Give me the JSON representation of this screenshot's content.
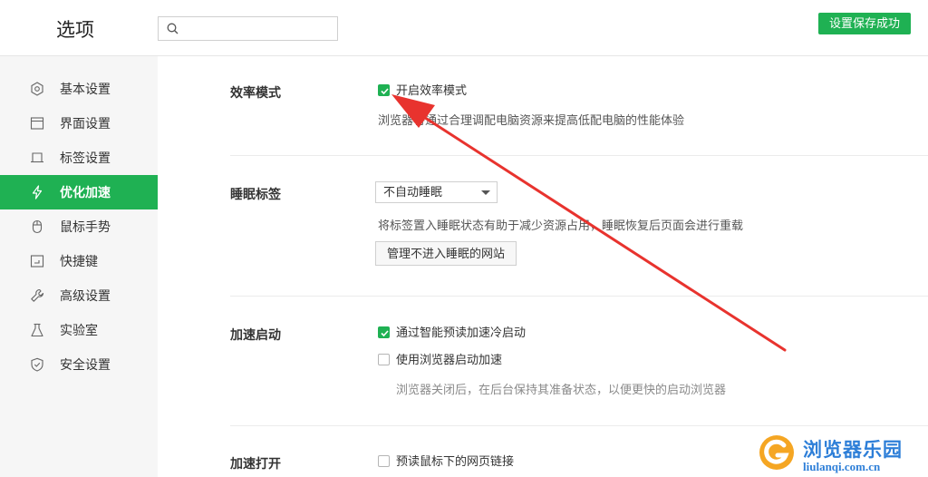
{
  "header": {
    "title": "选项",
    "search": {
      "value": "",
      "placeholder": "",
      "icon": "search-icon"
    },
    "save_status": "设置保存成功"
  },
  "sidebar": {
    "items": [
      {
        "label": "基本设置",
        "icon": "hexagon-settings-icon",
        "active": false
      },
      {
        "label": "界面设置",
        "icon": "window-icon",
        "active": false
      },
      {
        "label": "标签设置",
        "icon": "tab-icon",
        "active": false
      },
      {
        "label": "优化加速",
        "icon": "lightning-icon",
        "active": true
      },
      {
        "label": "鼠标手势",
        "icon": "mouse-icon",
        "active": false
      },
      {
        "label": "快捷键",
        "icon": "keyboard-shortcut-icon",
        "active": false
      },
      {
        "label": "高级设置",
        "icon": "wrench-icon",
        "active": false
      },
      {
        "label": "实验室",
        "icon": "flask-icon",
        "active": false
      },
      {
        "label": "安全设置",
        "icon": "shield-icon",
        "active": false
      }
    ]
  },
  "main": {
    "efficiency": {
      "title": "效率模式",
      "enable_label": "开启效率模式",
      "enable_checked": true,
      "description": "浏览器将通过合理调配电脑资源来提高低配电脑的性能体验"
    },
    "sleep_tabs": {
      "title": "睡眠标签",
      "select_value": "不自动睡眠",
      "description": "将标签置入睡眠状态有助于减少资源占用，睡眠恢复后页面会进行重载",
      "manage_button": "管理不进入睡眠的网站"
    },
    "startup_speed": {
      "title": "加速启动",
      "options": [
        {
          "label": "通过智能预读加速冷启动",
          "checked": true
        },
        {
          "label": "使用浏览器启动加速",
          "checked": false
        }
      ],
      "description": "浏览器关闭后，在后台保持其准备状态，以便更快的启动浏览器"
    },
    "open_speed": {
      "title": "加速打开",
      "options": [
        {
          "label": "预读鼠标下的网页链接",
          "checked": false
        }
      ]
    }
  },
  "watermark": {
    "title": "浏览器乐园",
    "url": "liulanqi.com.cn"
  },
  "colors": {
    "accent": "#1fb153",
    "annotation_arrow": "#e8332e",
    "watermark_blue": "#2e7fd8",
    "watermark_orange": "#f5a623"
  }
}
